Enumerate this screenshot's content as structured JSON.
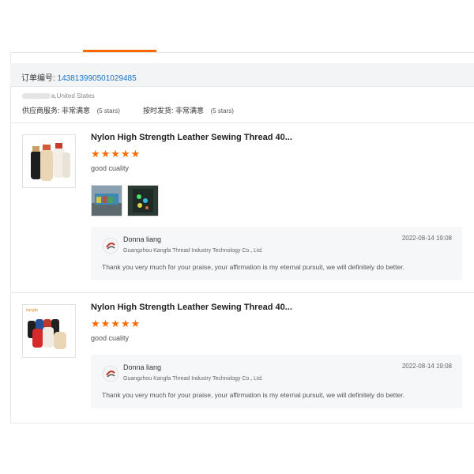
{
  "order": {
    "label": "订单编号:",
    "number": "143813990501029485"
  },
  "buyer": {
    "location": "a,United States"
  },
  "seller_ratings": {
    "service_label": "供应商服务:",
    "service_value": "非常满意",
    "service_stars": "(5 stars)",
    "shipping_label": "按时发货:",
    "shipping_value": "非常满意",
    "shipping_stars": "(5 stars)"
  },
  "reviews": [
    {
      "product_title": "Nylon High Strength Leather Sewing Thread 40...",
      "rating_stars": "★★★★★",
      "rating": 5,
      "comment": "good cuality",
      "reply": {
        "name": "Donna liang",
        "company": "Guangzhou Kangfa Thread Industry Technology Co., Ltd.",
        "date": "2022-08-14 19:08",
        "text": "Thank you very much for your praise, your affirmation is my eternal pursuit, we will definitely do better."
      }
    },
    {
      "product_title": "Nylon High Strength Leather Sewing Thread 40...",
      "rating_stars": "★★★★★",
      "rating": 5,
      "comment": "good cuality",
      "reply": {
        "name": "Donna liang",
        "company": "Guangzhou Kangfa Thread Industry Technology Co., Ltd.",
        "date": "2022-08-14 19:08",
        "text": "Thank you very much for your praise, your affirmation is my eternal pursuit, we will definitely do better."
      }
    }
  ],
  "colors": {
    "accent": "#ff6a00",
    "link": "#1a73c8",
    "reply_bg": "#f6f7f9"
  }
}
